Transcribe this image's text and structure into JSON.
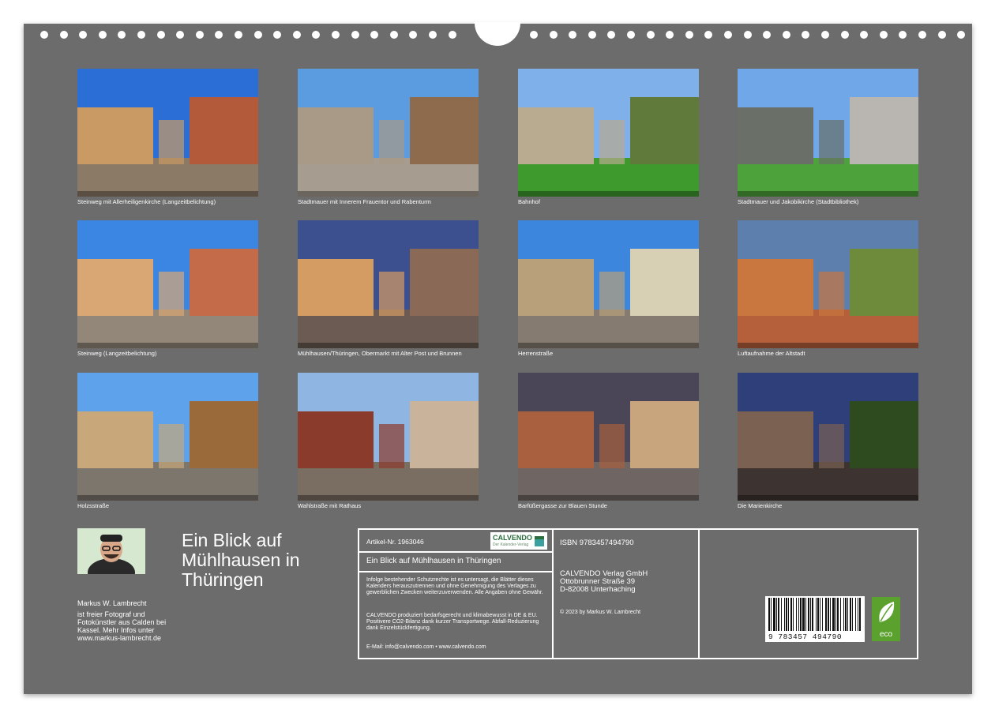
{
  "photos": [
    {
      "caption": "Steinweg mit Allerheiligenkirche (Langzeitbelichtung)",
      "sky": "#2b6fd6",
      "ground": "#8a7a66",
      "b1": "#c99a63",
      "b2": "#b35a3b"
    },
    {
      "caption": "Stadtmauer mit Innerem Frauentor und Rabenturm",
      "sky": "#5b9be0",
      "ground": "#a69c8f",
      "b1": "#a89a86",
      "b2": "#8f6b4d"
    },
    {
      "caption": "Bahnhof",
      "sky": "#7fb0ea",
      "ground": "#3f9a2e",
      "b1": "#b8ab8f",
      "b2": "#5f7a3a"
    },
    {
      "caption": "Stadtmauer und Jakobikirche (Stadtbibliothek)",
      "sky": "#6fa7e8",
      "ground": "#4da23b",
      "b1": "#6a6f68",
      "b2": "#b9b6b1"
    },
    {
      "caption": "Steinweg (Langzeitbelichtung)",
      "sky": "#3b86e3",
      "ground": "#93877a",
      "b1": "#d8a774",
      "b2": "#c46c4a"
    },
    {
      "caption": "Mühlhausen/Thüringen, Obermarkt mit Alter Post und Brunnen",
      "sky": "#3c4f8f",
      "ground": "#6b5b52",
      "b1": "#d49b63",
      "b2": "#8a6a57"
    },
    {
      "caption": "Herrenstraße",
      "sky": "#3d86dd",
      "ground": "#857b70",
      "b1": "#b7a07a",
      "b2": "#d8d0b4"
    },
    {
      "caption": "Luftaufnahme der Altstadt",
      "sky": "#5c7fae",
      "ground": "#b5603b",
      "b1": "#c9763f",
      "b2": "#6e8b3c"
    },
    {
      "caption": "Holzsstraße",
      "sky": "#5da2ea",
      "ground": "#7d766d",
      "b1": "#c8a87a",
      "b2": "#9b6a3a"
    },
    {
      "caption": "Wahlstraße mit Rathaus",
      "sky": "#8fb6e2",
      "ground": "#7a6d62",
      "b1": "#8b3b2c",
      "b2": "#c9b39a"
    },
    {
      "caption": "Barfüßergasse zur Blauen Stunde",
      "sky": "#4a4658",
      "ground": "#6f6663",
      "b1": "#a8603f",
      "b2": "#c9a57e"
    },
    {
      "caption": "Die Marienkirche",
      "sky": "#2e3f7a",
      "ground": "#3d3431",
      "b1": "#7b6152",
      "b2": "#2e4a1f"
    }
  ],
  "title": "Ein Blick auf Mühlhausen in Thüringen",
  "author": {
    "name": "Markus W. Lambrecht",
    "bio": "ist freier Fotograf und Fotokünstler aus Calden bei Kassel. Mehr Infos unter www.markus-lambrecht.de"
  },
  "info": {
    "article": "Artikel-Nr. 1963046",
    "logo": "CALVENDO",
    "logo_sub": "Der Kalender-Verlag",
    "product_title": "Ein Blick auf Mühlhausen in Thüringen",
    "notice1": "Infolge bestehender Schutzrechte ist es untersagt, die Blätter dieses Kalenders herauszutrennen und ohne Genehmigung des Verlages zu gewerblichen Zwecken weiterzuverwenden. Alle Angaben ohne Gewähr.",
    "notice2": "CALVENDO produziert bedarfsgerecht und klimabewusst in DE & EU. Positivere CO2-Bilanz dank kurzer Transportwege. Abfall-Reduzierung dank Einzelstückfertigung.",
    "contact": "E-Mail: info@calvendo.com • www.calvendo.com",
    "isbn": "ISBN 9783457494790",
    "publisher_name": "CALVENDO Verlag GmbH",
    "publisher_street": "Ottobrunner Straße 39",
    "publisher_city": "D-82008 Unterhaching",
    "copyright": "© 2023 by Markus W. Lambrecht",
    "barcode_number": "9 783457 494790",
    "eco_label": "eco"
  }
}
